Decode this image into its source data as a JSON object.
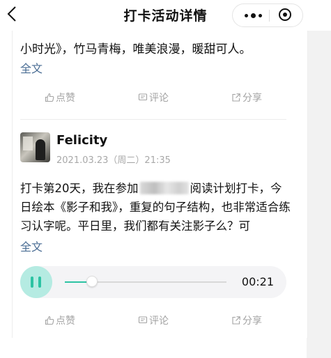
{
  "nav": {
    "title": "打卡活动详情",
    "back_icon": "chevron-left-icon",
    "more_icon": "more-dots-icon",
    "close_icon": "target-icon"
  },
  "previous_post": {
    "text_tail": "小时光》，竹马青梅，唯美浪漫，暖甜可人。",
    "read_more": "全文",
    "actions": {
      "like": "点赞",
      "comment": "评论",
      "share": "分享"
    }
  },
  "post": {
    "username": "Felicity",
    "time": "2021.03.23（周二）21:35",
    "text_before_blur": "打卡第20天，我在参加",
    "text_after_blur": "阅读计划打卡，今日绘本《影子和我》，重复的句子结构，也非常适合练习认字呢。平日里，我们都有关注影子么？可",
    "read_more": "全文",
    "audio": {
      "duration": "00:21",
      "progress": 0.17,
      "state": "playing"
    },
    "actions": {
      "like": "点赞",
      "comment": "评论",
      "share": "分享"
    }
  },
  "colors": {
    "accent": "#2cc3a3",
    "link": "#4a6d94",
    "muted": "#a3a3a3"
  }
}
